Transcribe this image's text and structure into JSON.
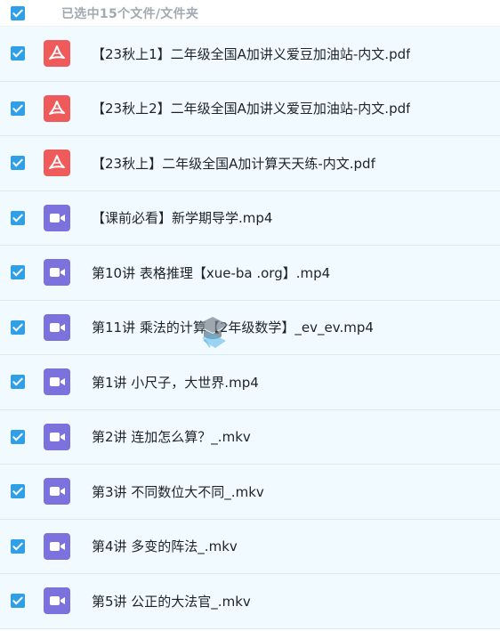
{
  "header": {
    "title": "已选中15个文件/文件夹",
    "checked": true
  },
  "files": [
    {
      "name": "【23秋上1】二年级全国A加讲义爱豆加油站-内文.pdf",
      "type": "pdf",
      "icon": "pdf-file-icon",
      "checked": true
    },
    {
      "name": "【23秋上2】二年级全国A加讲义爱豆加油站-内文.pdf",
      "type": "pdf",
      "icon": "pdf-file-icon",
      "checked": true
    },
    {
      "name": "【23秋上】二年级全国A加计算天天练-内文.pdf",
      "type": "pdf",
      "icon": "pdf-file-icon",
      "checked": true
    },
    {
      "name": "【课前必看】新学期导学.mp4",
      "type": "video",
      "icon": "video-file-icon",
      "checked": true
    },
    {
      "name": "第10讲 表格推理【xue-ba .org】.mp4",
      "type": "video",
      "icon": "video-file-icon",
      "checked": true
    },
    {
      "name": "第11讲 乘法的计算【2年级数学】_ev_ev.mp4",
      "type": "video",
      "icon": "video-file-icon",
      "checked": true
    },
    {
      "name": "第1讲 小尺子，大世界.mp4",
      "type": "video",
      "icon": "video-file-icon",
      "checked": true
    },
    {
      "name": "第2讲 连加怎么算？_.mkv",
      "type": "video",
      "icon": "video-file-icon",
      "checked": true
    },
    {
      "name": "第3讲 不同数位大不同_.mkv",
      "type": "video",
      "icon": "video-file-icon",
      "checked": true
    },
    {
      "name": "第4讲 多变的阵法_.mkv",
      "type": "video",
      "icon": "video-file-icon",
      "checked": true
    },
    {
      "name": "第5讲 公正的大法官_.mkv",
      "type": "video",
      "icon": "video-file-icon",
      "checked": true
    }
  ],
  "colors": {
    "checkbox": "#2f9fe8",
    "pdf": "#ef5b5b",
    "video": "#7b72de",
    "row_background": "#f1fbff",
    "header_text": "#a2a9b1"
  },
  "watermark_icon": "graduation-cap-icon"
}
